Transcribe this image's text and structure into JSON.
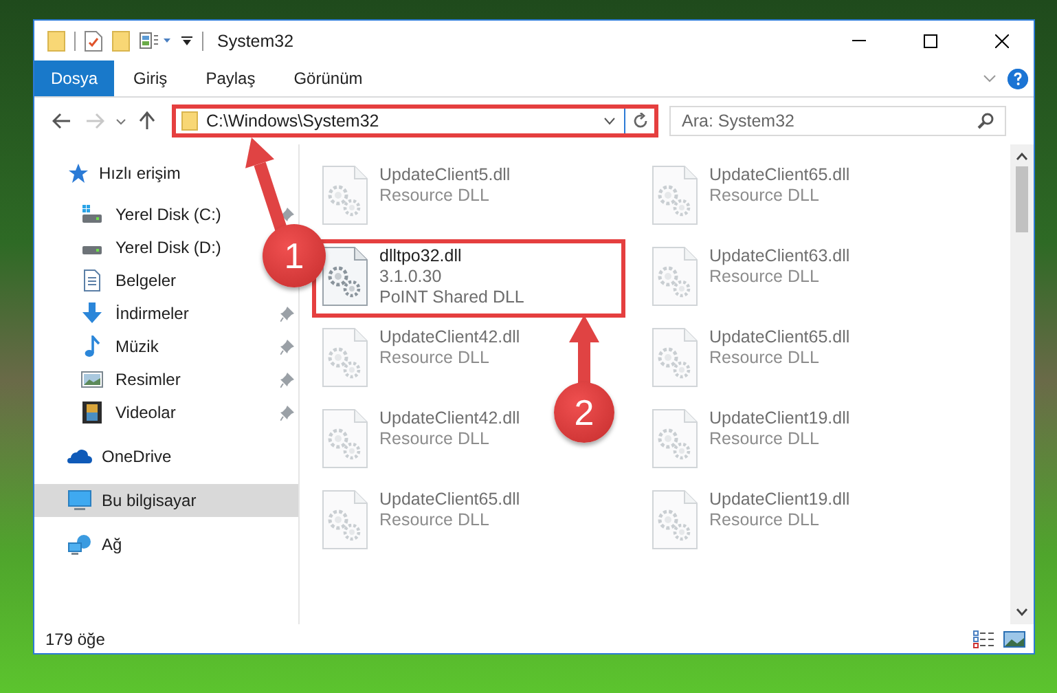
{
  "window": {
    "title": "System32"
  },
  "ribbon_tabs": [
    {
      "label": "Dosya",
      "kind": "file-menu"
    },
    {
      "label": "Giriş",
      "kind": "tab"
    },
    {
      "label": "Paylaş",
      "kind": "tab"
    },
    {
      "label": "Görünüm",
      "kind": "tab"
    }
  ],
  "address": {
    "path": "C:\\Windows\\System32",
    "highlighted": true
  },
  "search": {
    "placeholder": "Ara: System32"
  },
  "nav": {
    "items": [
      {
        "label": "Hızlı erişim",
        "kind": "star",
        "selected": false,
        "children": [
          {
            "label": "Yerel Disk (C:)",
            "kind": "drive-win",
            "pinned": true,
            "selected": false
          },
          {
            "label": "Yerel Disk (D:)",
            "kind": "drive",
            "pinned": false,
            "selected": false
          },
          {
            "label": "Belgeler",
            "kind": "docs",
            "pinned": false,
            "selected": false
          },
          {
            "label": "İndirmeler",
            "kind": "download",
            "pinned": true,
            "selected": false
          },
          {
            "label": "Müzik",
            "kind": "music",
            "pinned": true,
            "selected": false
          },
          {
            "label": "Resimler",
            "kind": "pictures",
            "pinned": true,
            "selected": false
          },
          {
            "label": "Videolar",
            "kind": "videos",
            "pinned": true,
            "selected": false
          }
        ]
      },
      {
        "label": "OneDrive",
        "kind": "cloud",
        "selected": false
      },
      {
        "label": "Bu bilgisayar",
        "kind": "computer",
        "selected": true
      },
      {
        "label": "Ağ",
        "kind": "network",
        "selected": false
      }
    ]
  },
  "files": [
    {
      "name": "UpdateClient5.dll",
      "lines": [
        "Resource DLL"
      ],
      "blurred": true,
      "highlighted": false
    },
    {
      "name": "UpdateClient65.dll",
      "lines": [
        "Resource DLL"
      ],
      "blurred": true,
      "highlighted": false
    },
    {
      "name": "dlltpo32.dll",
      "lines": [
        "3.1.0.30",
        "PoINT Shared DLL"
      ],
      "blurred": false,
      "highlighted": true
    },
    {
      "name": "UpdateClient63.dll",
      "lines": [
        "Resource DLL"
      ],
      "blurred": true,
      "highlighted": false
    },
    {
      "name": "UpdateClient42.dll",
      "lines": [
        "Resource DLL"
      ],
      "blurred": true,
      "highlighted": false
    },
    {
      "name": "UpdateClient65.dll",
      "lines": [
        "Resource DLL"
      ],
      "blurred": true,
      "highlighted": false
    },
    {
      "name": "UpdateClient42.dll",
      "lines": [
        "Resource DLL"
      ],
      "blurred": true,
      "highlighted": false
    },
    {
      "name": "UpdateClient19.dll",
      "lines": [
        "Resource DLL"
      ],
      "blurred": true,
      "highlighted": false
    },
    {
      "name": "UpdateClient65.dll",
      "lines": [
        "Resource DLL"
      ],
      "blurred": true,
      "highlighted": false
    },
    {
      "name": "UpdateClient19.dll",
      "lines": [
        "Resource DLL"
      ],
      "blurred": true,
      "highlighted": false
    }
  ],
  "status_bar": {
    "count": "179 öğe"
  },
  "callouts": [
    {
      "number": "1"
    },
    {
      "number": "2"
    }
  ]
}
